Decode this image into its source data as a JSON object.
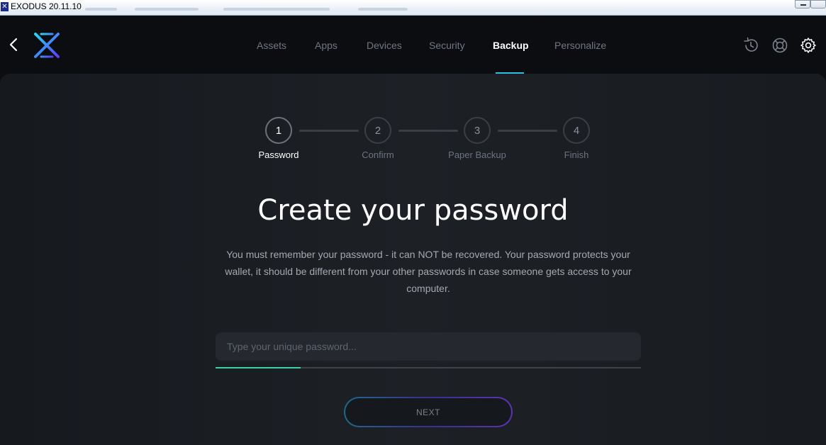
{
  "window": {
    "title": "EXODUS 20.11.10"
  },
  "nav": {
    "tabs": [
      {
        "label": "Assets"
      },
      {
        "label": "Apps"
      },
      {
        "label": "Devices"
      },
      {
        "label": "Security"
      },
      {
        "label": "Backup",
        "active": true
      },
      {
        "label": "Personalize"
      }
    ]
  },
  "header_icons": [
    "history-icon",
    "support-icon",
    "gear-icon"
  ],
  "steps": [
    {
      "number": "1",
      "label": "Password",
      "active": true
    },
    {
      "number": "2",
      "label": "Confirm"
    },
    {
      "number": "3",
      "label": "Paper Backup"
    },
    {
      "number": "4",
      "label": "Finish"
    }
  ],
  "content": {
    "heading": "Create your password",
    "description": "You must remember your password - it can NOT be recovered. Your password protects your wallet, it should be different from your other passwords in case someone gets access to your computer.",
    "password_value": "",
    "password_placeholder": "Type your unique password...",
    "strength_fraction": 0.2,
    "next_label": "NEXT"
  },
  "colors": {
    "accent": "#27c1e4",
    "strength": "#3ed1a5",
    "logo_start": "#2bd3f3",
    "logo_end": "#5b3ff5"
  }
}
